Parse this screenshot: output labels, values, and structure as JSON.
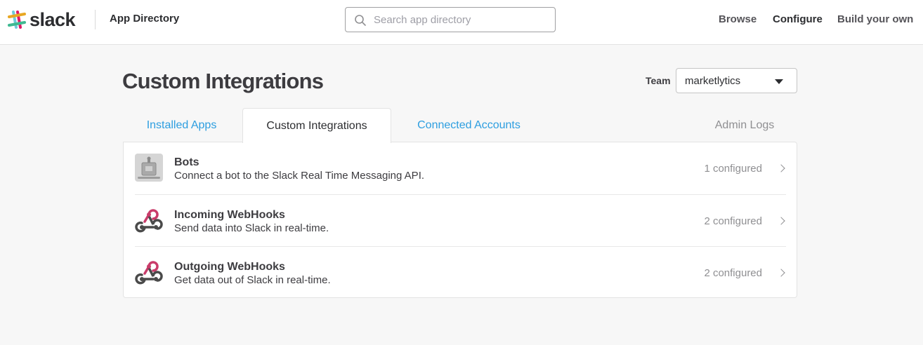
{
  "header": {
    "logo_text": "slack",
    "section_title": "App Directory",
    "search_placeholder": "Search app directory",
    "nav": [
      "Browse",
      "Configure",
      "Build your own"
    ],
    "active_nav": "Configure"
  },
  "page": {
    "title": "Custom Integrations",
    "team_label": "Team",
    "team_value": "marketlytics"
  },
  "tabs": [
    {
      "label": "Installed Apps",
      "state": "link"
    },
    {
      "label": "Custom Integrations",
      "state": "active"
    },
    {
      "label": "Connected Accounts",
      "state": "link"
    },
    {
      "label": "Admin Logs",
      "state": "muted"
    }
  ],
  "integrations": [
    {
      "name": "Bots",
      "description": "Connect a bot to the Slack Real Time Messaging API.",
      "count": "1 configured",
      "icon": "bot-icon"
    },
    {
      "name": "Incoming WebHooks",
      "description": "Send data into Slack in real-time.",
      "count": "2 configured",
      "icon": "webhook-icon"
    },
    {
      "name": "Outgoing WebHooks",
      "description": "Get data out of Slack in real-time.",
      "count": "2 configured",
      "icon": "webhook-icon"
    }
  ],
  "colors": {
    "link": "#2d9ee0",
    "webhook_pink": "#c93c6a",
    "webhook_dark": "#4a4a4a"
  }
}
